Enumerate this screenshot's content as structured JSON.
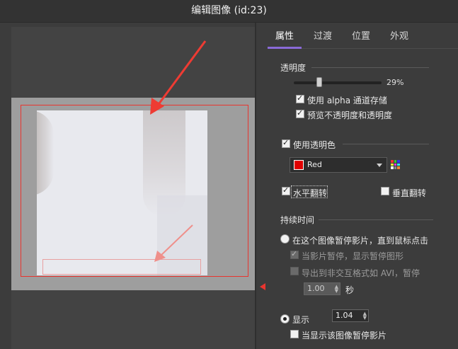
{
  "window": {
    "title": "编辑图像 (id:23)"
  },
  "tabs": [
    {
      "label": "属性",
      "active": true
    },
    {
      "label": "过渡",
      "active": false
    },
    {
      "label": "位置",
      "active": false
    },
    {
      "label": "外观",
      "active": false
    }
  ],
  "opacity": {
    "label": "透明度",
    "value_text": "29%",
    "value": 29,
    "use_alpha_label": "使用 alpha 通道存储",
    "use_alpha_checked": true,
    "preview_label": "预览不透明度和透明度",
    "preview_checked": true
  },
  "transparent_color": {
    "label": "使用透明色",
    "checked": true,
    "selected": "Red",
    "swatch_color": "#e00000"
  },
  "flip": {
    "horizontal_label": "水平翻转",
    "horizontal_checked": true,
    "vertical_label": "垂直翻转",
    "vertical_checked": false
  },
  "duration": {
    "label": "持续时间",
    "pause_option_label": "在这个图像暂停影片，直到鼠标点击",
    "pause_option_selected": false,
    "show_pause_label": "当影片暂停，显示暂停图形",
    "show_pause_checked": true,
    "export_label": "导出到非交互格式如 AVI，暂停",
    "export_checked": false,
    "export_value": "1.00",
    "export_unit": "秒",
    "display_label": "显示",
    "display_selected": true,
    "display_value": "1.04",
    "when_display_label": "当显示该图像暂停影片",
    "when_display_checked": false
  },
  "colors": {
    "accent": "#8a6ad8",
    "frame": "#e8352f"
  }
}
